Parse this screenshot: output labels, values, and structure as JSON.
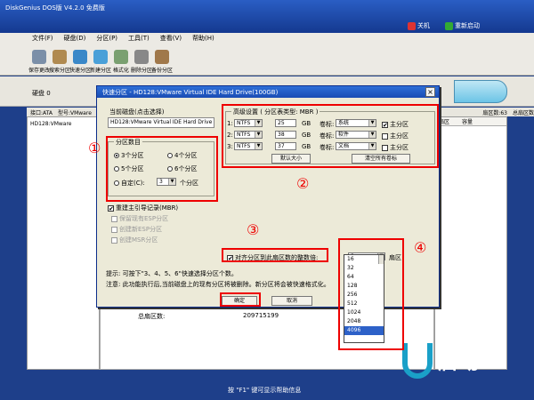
{
  "app": {
    "title": "DiskGenius DOS版 V4.2.0 免费版",
    "btn_close": "关机",
    "btn_reboot": "重新启动"
  },
  "menu": [
    "文件(F)",
    "硬盘(D)",
    "分区(P)",
    "工具(T)",
    "查看(V)",
    "帮助(H)"
  ],
  "toolbar": [
    "保存更改",
    "搜索分区",
    "快速分区",
    "新建分区",
    "格式化",
    "删除分区",
    "备份分区"
  ],
  "disk_label": "硬盘 0",
  "info": {
    "iface": "接口:ATA",
    "model": "型号:VMware",
    "sectors": "扇区数:63",
    "total": "总扇区数"
  },
  "left_tree": "HD128:VMware",
  "right_headers": [
    "扇区",
    "容量"
  ],
  "bottom": {
    "label": "总扇区数:",
    "value": "209715199"
  },
  "status_hint": "按 \"F1\" 键可显示帮助信息",
  "brand": "启动",
  "dialog": {
    "title": "快速分区 - HD128:VMware Virtual IDE Hard Drive(100GB)",
    "current_disk_title": "当前磁盘(点击选择)",
    "current_disk": "HD128:VMware Virtual IDE Hard Drive",
    "count_title": "分区数目",
    "counts": [
      "3个分区",
      "4个分区",
      "5个分区",
      "6个分区"
    ],
    "custom_label": "自定(C):",
    "custom_value": "3",
    "custom_unit": "个分区",
    "rebuild_mbr": "重建主引导记录(MBR)",
    "opts_disabled": [
      "保留现有ESP分区",
      "创建新ESP分区",
      "创建MSR分区"
    ],
    "adv_title": "高级设置 ( 分区表类型: MBR )",
    "partitions": [
      {
        "idx": "1:",
        "fs": "NTFS",
        "size": "25",
        "unit": "GB",
        "vol_label": "卷标:",
        "vol": "系统",
        "primary": "主分区",
        "checked": true
      },
      {
        "idx": "2:",
        "fs": "NTFS",
        "size": "38",
        "unit": "GB",
        "vol_label": "卷标:",
        "vol": "软件",
        "primary": "主分区",
        "checked": false
      },
      {
        "idx": "3:",
        "fs": "NTFS",
        "size": "37",
        "unit": "GB",
        "vol_label": "卷标:",
        "vol": "文档",
        "primary": "主分区",
        "checked": false
      }
    ],
    "btn_default_size": "默认大小",
    "btn_clear_labels": "清空所有卷标",
    "align_label": "对齐分区到此扇区数的整数倍:",
    "align_value": "8",
    "align_unit": "扇区",
    "tip1": "提示: 可按下\"3、4、5、6\"快速选择分区个数。",
    "tip2": "注意: 此功能执行后,当前磁盘上的现有分区将被删除。新分区将会被快速格式化。",
    "btn_ok": "确定",
    "btn_cancel": "取消",
    "align_options": [
      "16",
      "32",
      "64",
      "128",
      "256",
      "512",
      "1024",
      "2048",
      "4096"
    ],
    "align_selected": "4096",
    "markers": [
      "①",
      "②",
      "③",
      "④"
    ]
  }
}
